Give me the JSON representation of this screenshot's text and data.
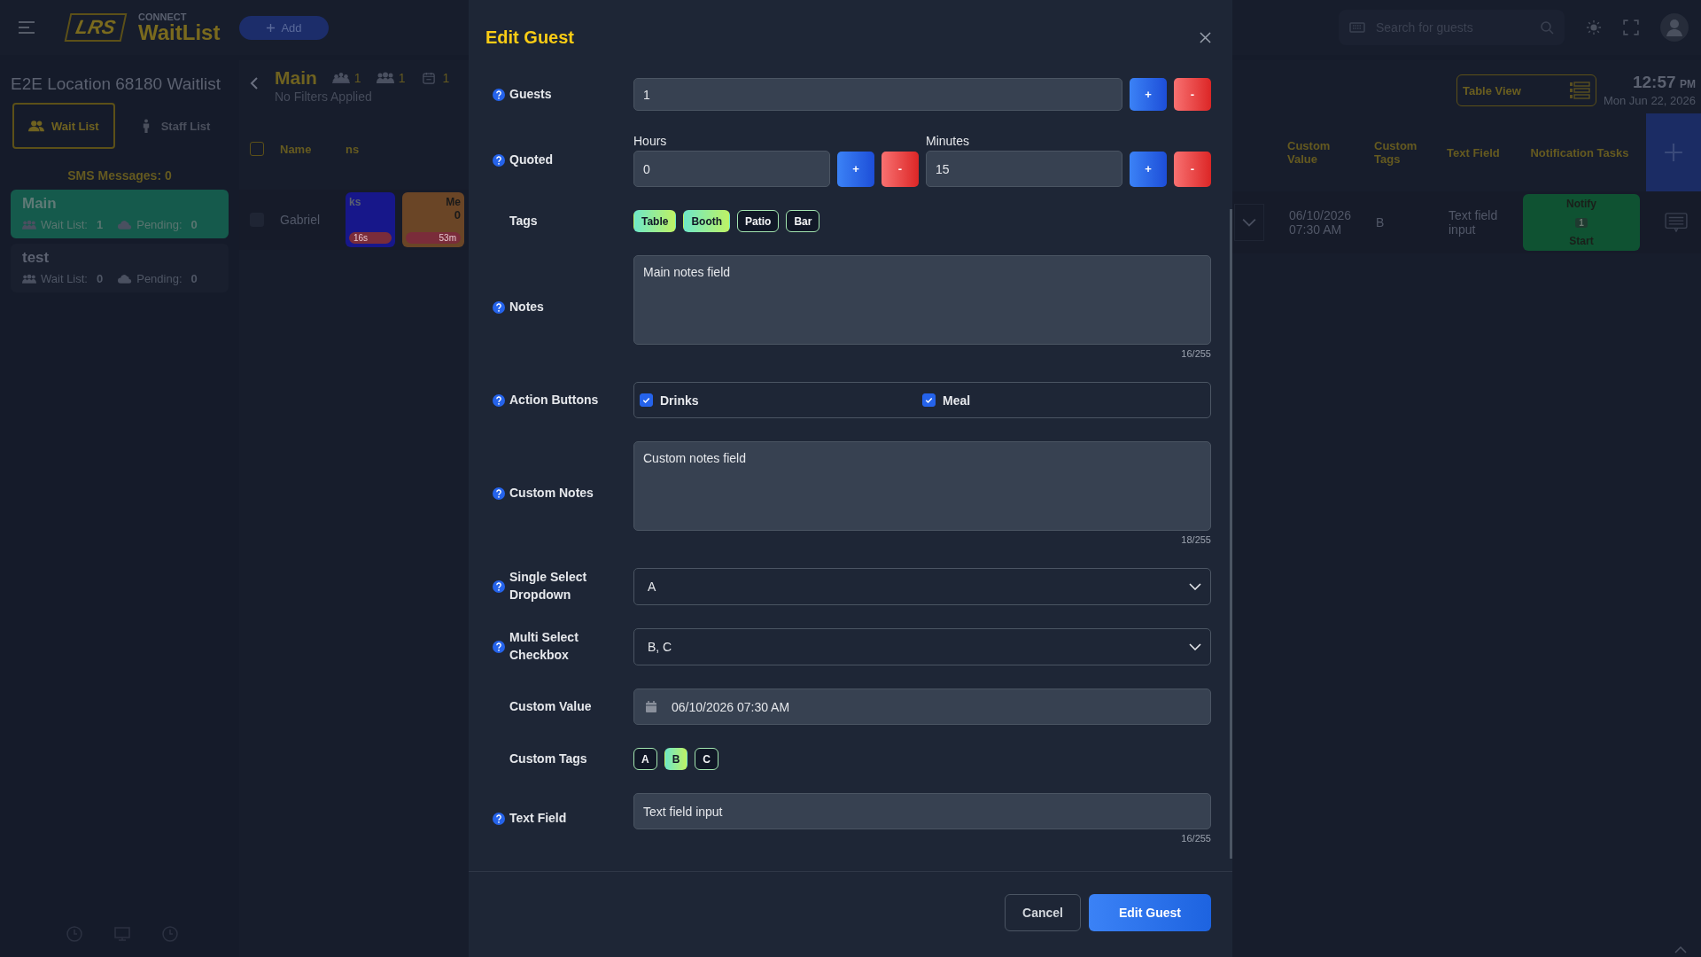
{
  "header": {
    "logo": "LRS",
    "brand_top": "CONNECT",
    "brand": "WaitList",
    "add_button": "Add",
    "search": {
      "placeholder": "Search for guests"
    }
  },
  "sidebar": {
    "title": "E2E Location 68180 Waitlist",
    "tabs": [
      {
        "label": "Wait List",
        "kind": "group",
        "selected": true
      },
      {
        "label": "Staff List",
        "kind": "person",
        "selected": false
      }
    ],
    "sms": "SMS Messages: 0",
    "lists": [
      {
        "name": "Main",
        "selected": true,
        "wait_label": "Wait List:",
        "wait": "1",
        "pending_label": "Pending:",
        "pending": "0"
      },
      {
        "name": "test",
        "selected": false,
        "wait_label": "Wait List:",
        "wait": "0",
        "pending_label": "Pending:",
        "pending": "0"
      }
    ]
  },
  "list_header": {
    "title": "Main",
    "counts": [
      {
        "kind": "crowd",
        "value": "1"
      },
      {
        "kind": "group",
        "value": "1"
      },
      {
        "kind": "calendar",
        "value": "1"
      }
    ],
    "filters": "No Filters Applied",
    "view_button": "Table View",
    "time": "12:57",
    "ampm": "PM",
    "date": "Mon Jun 22, 2026"
  },
  "table": {
    "select_all_checked": false,
    "columns_left": [
      "Name",
      "ns"
    ],
    "columns_right": [
      "Custom Value",
      "Custom Tags",
      "Text Field",
      "Notification Tasks"
    ],
    "rows": [
      {
        "checked": false,
        "name": "Gabriel",
        "cards": [
          {
            "kind": "blue",
            "title": "ks",
            "timer": "16s"
          },
          {
            "kind": "orange",
            "title": "Me",
            "count": "0",
            "timer": "53m"
          }
        ],
        "custom_value": "06/10/2026 07:30 AM",
        "custom_tags": "B",
        "text_field": "Text field input",
        "task": {
          "title": "Notify",
          "count": "1",
          "action": "Start"
        }
      }
    ]
  },
  "modal": {
    "title": "Edit Guest",
    "plus": "+",
    "minus": "-",
    "cancel": "Cancel",
    "submit": "Edit Guest",
    "fields": [
      {
        "kind": "stepper",
        "label": "Guests",
        "help": true,
        "value": "1"
      },
      {
        "kind": "quoted",
        "label": "Quoted",
        "help": true,
        "parts": [
          {
            "label": "Hours",
            "value": "0"
          },
          {
            "label": "Minutes",
            "value": "15"
          }
        ]
      },
      {
        "kind": "tags",
        "label": "Tags",
        "help": false,
        "tags": [
          {
            "label": "Table",
            "selected": true
          },
          {
            "label": "Booth",
            "selected": true
          },
          {
            "label": "Patio",
            "selected": false
          },
          {
            "label": "Bar",
            "selected": false
          }
        ]
      },
      {
        "kind": "textarea",
        "label": "Notes",
        "help": true,
        "value": "Main notes field",
        "counter": "16/255"
      },
      {
        "kind": "checks",
        "label": "Action Buttons",
        "help": true,
        "options": [
          {
            "label": "Drinks",
            "checked": true
          },
          {
            "label": "Meal",
            "checked": true
          }
        ]
      },
      {
        "kind": "textarea",
        "label": "Custom Notes",
        "help": true,
        "value": "Custom notes field",
        "counter": "18/255"
      },
      {
        "kind": "select",
        "label": "Single Select Dropdown",
        "help": true,
        "value": "A"
      },
      {
        "kind": "select",
        "label": "Multi Select Checkbox",
        "help": true,
        "value": "B, C"
      },
      {
        "kind": "date",
        "label": "Custom Value",
        "help": false,
        "value": "06/10/2026 07:30 AM"
      },
      {
        "kind": "tags",
        "label": "Custom Tags",
        "help": false,
        "tags": [
          {
            "label": "A",
            "selected": false
          },
          {
            "label": "B",
            "selected": true
          },
          {
            "label": "C",
            "selected": false
          }
        ]
      },
      {
        "kind": "text",
        "label": "Text Field",
        "help": true,
        "value": "Text field input",
        "counter": "16/255"
      }
    ]
  }
}
